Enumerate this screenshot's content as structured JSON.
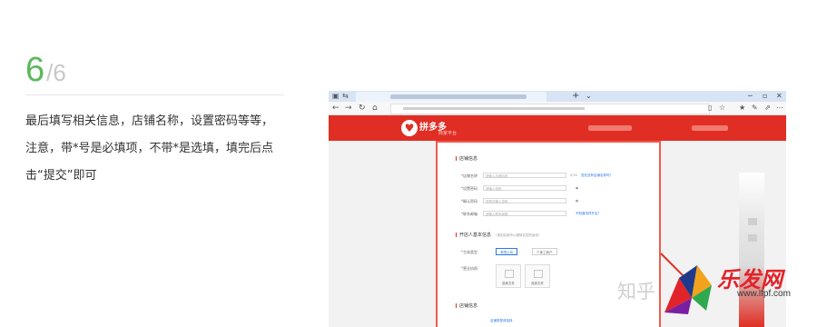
{
  "step": {
    "current": "6",
    "total": "/6",
    "description": "最后填写相关信息，店铺名称，设置密码等等，注意，带*号是必填项，不带*是选填，填完后点击“提交”即可"
  },
  "browser": {
    "new_tab": "+",
    "tab_dropdown": "⌄"
  },
  "site": {
    "brand": "拼多多",
    "subtitle": "商家平台"
  },
  "form": {
    "section1_title": "店铺信息",
    "fields": [
      {
        "label": "*店铺名称",
        "placeholder": "请输入店铺名称",
        "note": "您还没有店铺名称吗？"
      },
      {
        "label": "*设置密码",
        "placeholder": "请输入密码",
        "note": ""
      },
      {
        "label": "*确认密码",
        "placeholder": "请再次输入密码",
        "note": ""
      },
      {
        "label": "*联系邮箱",
        "placeholder": "请输入联系邮箱",
        "note": "不知道怎样开店？"
      }
    ],
    "section2_title": "开店人基本信息",
    "section2_hint": "（请如实填写以便核实您的身份）",
    "shop_type_label": "*主体类型",
    "shop_type_options": [
      "有限公司",
      "个体工商户"
    ],
    "cert_label": "*营业执照",
    "upload_labels": [
      "选择文件",
      "选择文件"
    ],
    "section3_title": "店铺信息",
    "section3_note": "店铺类型请选择"
  },
  "watermarks": {
    "zhihu": "知乎",
    "corner_brand": "乐发网",
    "corner_url": "www.lfpf.com"
  }
}
